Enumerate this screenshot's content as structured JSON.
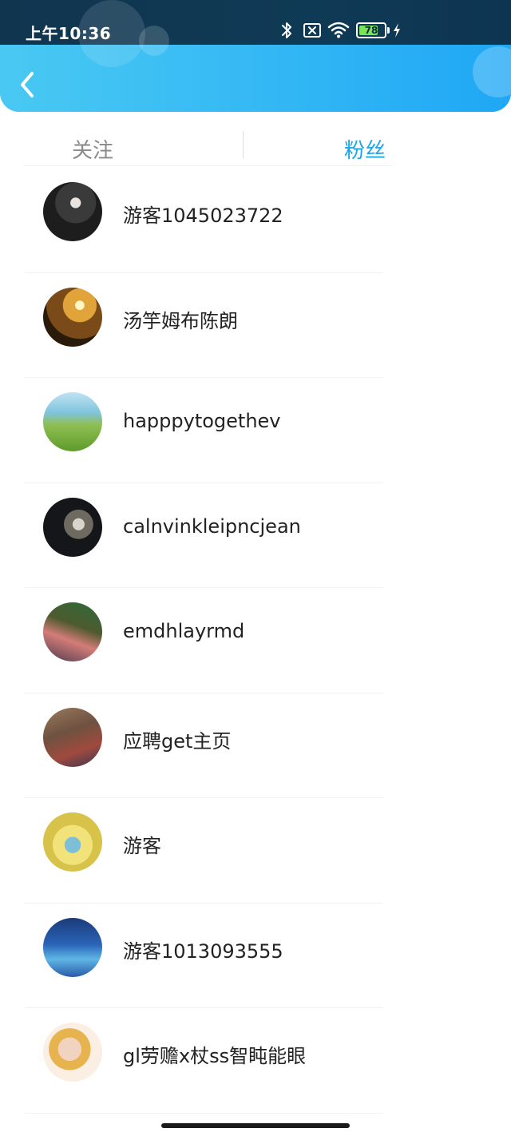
{
  "status_bar": {
    "time": "上午10:36",
    "battery_percent": "78",
    "battery_level": 0.78,
    "icons": [
      "bluetooth-icon",
      "sim-off-icon",
      "wifi-icon",
      "battery-icon",
      "charging-icon"
    ]
  },
  "header": {
    "back_icon": "chevron-left-icon"
  },
  "tabs": [
    {
      "label": "关注",
      "active": false
    },
    {
      "label": "粉丝",
      "active": true
    }
  ],
  "fans": [
    {
      "name": "游客1045023722"
    },
    {
      "name": "汤竽姆布陈朗"
    },
    {
      "name": "happpytogethev"
    },
    {
      "name": "calnvinkleipncjean"
    },
    {
      "name": "emdhlayrmd"
    },
    {
      "name": "应聘get主页"
    },
    {
      "name": "游客"
    },
    {
      "name": "游客1013093555"
    },
    {
      "name": "gl劳赡x杖ss智盹能眼"
    }
  ],
  "colors": {
    "accent": "#1aa7e8",
    "header_gradient_start": "#49c9f2",
    "header_gradient_end": "#1fa7f5",
    "inactive_tab": "#8a8a8a"
  }
}
